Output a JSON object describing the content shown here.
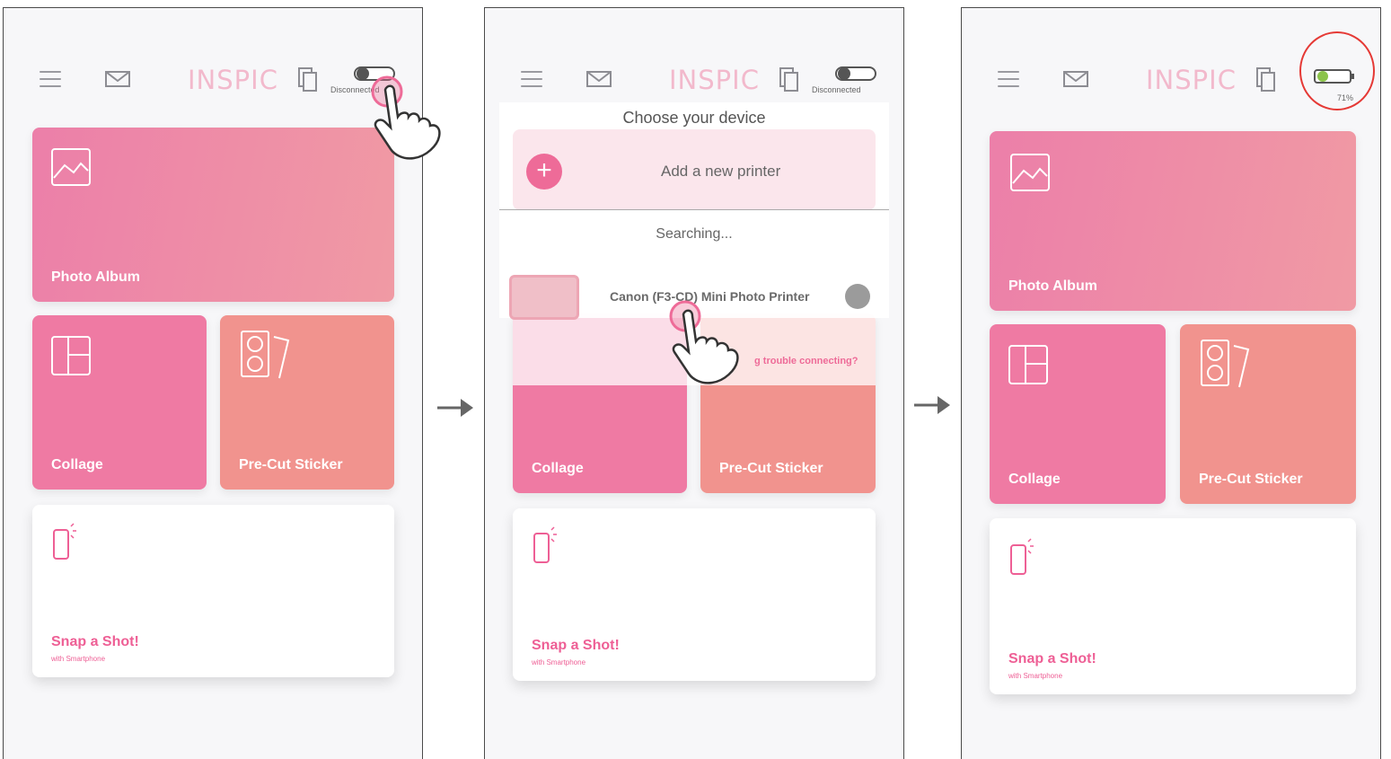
{
  "brand": {
    "logo": "INSPIC",
    "accent": "#ee6b98",
    "album_color": "#ec7fa9",
    "collage_color": "#ef7aa3",
    "sticker_color": "#f1938e",
    "alert_circle": "#e53935",
    "connected_dot": "#8bc34a"
  },
  "panel1": {
    "status": "Disconnected",
    "cards": {
      "album": "Photo Album",
      "collage": "Collage",
      "sticker": "Pre-Cut Sticker",
      "snap": "Snap a Shot!",
      "snap_sub": "with Smartphone"
    }
  },
  "panel2": {
    "status": "Disconnected",
    "dialog": {
      "title": "Choose your device",
      "add_printer": "Add a new printer",
      "searching": "Searching...",
      "printer_name": "Canon (F3-CD) Mini Photo Printer",
      "trouble": "g trouble connecting?"
    },
    "cards": {
      "collage": "Collage",
      "sticker": "Pre-Cut Sticker",
      "snap": "Snap a Shot!",
      "snap_sub": "with Smartphone"
    }
  },
  "panel3": {
    "battery": "71%",
    "cards": {
      "album": "Photo Album",
      "collage": "Collage",
      "sticker": "Pre-Cut Sticker",
      "snap": "Snap a Shot!",
      "snap_sub": "with Smartphone"
    }
  }
}
